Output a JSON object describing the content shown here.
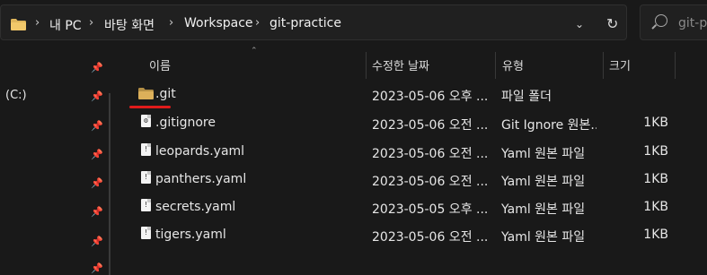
{
  "address_bar": {
    "crumbs": [
      "내 PC",
      "바탕 화면",
      "Workspace",
      "git-practice"
    ],
    "separator": "›",
    "recent_icon": "chevron-down-icon",
    "refresh_icon": "refresh-icon"
  },
  "search": {
    "placeholder": "git-prac"
  },
  "nav": {
    "drive_label": "(C:)"
  },
  "columns": {
    "name": "이름",
    "date": "수정한 날짜",
    "type": "유형",
    "size": "크기"
  },
  "files": [
    {
      "name": ".git",
      "date": "2023-05-06 오후 ...",
      "type": "파일 폴더",
      "size": "",
      "icon": "folder-icon"
    },
    {
      "name": ".gitignore",
      "date": "2023-05-06 오전 ...",
      "type": "Git Ignore 원본...",
      "size": "1KB",
      "icon": "gitignore-file-icon"
    },
    {
      "name": "leopards.yaml",
      "date": "2023-05-06 오전 ...",
      "type": "Yaml 원본 파일",
      "size": "1KB",
      "icon": "yaml-file-icon"
    },
    {
      "name": "panthers.yaml",
      "date": "2023-05-06 오전 ...",
      "type": "Yaml 원본 파일",
      "size": "1KB",
      "icon": "yaml-file-icon"
    },
    {
      "name": "secrets.yaml",
      "date": "2023-05-05 오후 ...",
      "type": "Yaml 원본 파일",
      "size": "1KB",
      "icon": "yaml-file-icon"
    },
    {
      "name": "tigers.yaml",
      "date": "2023-05-06 오전 ...",
      "type": "Yaml 원본 파일",
      "size": "1KB",
      "icon": "yaml-file-icon"
    }
  ],
  "colors": {
    "background": "#191919",
    "folder": "#dcb05a",
    "highlight_underline": "#e01b1b"
  }
}
